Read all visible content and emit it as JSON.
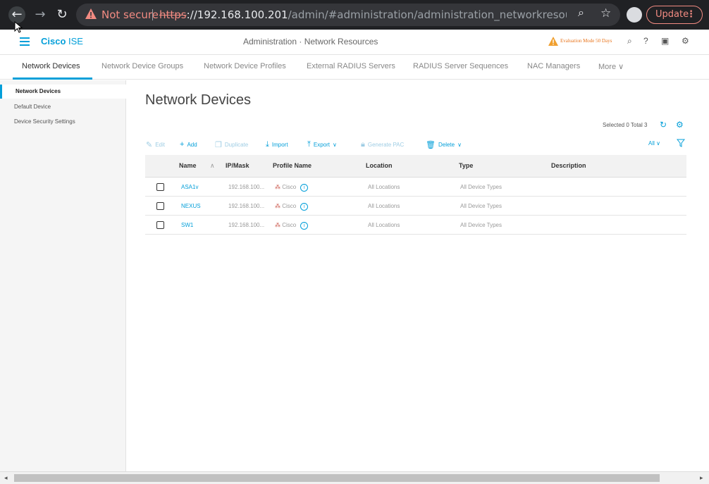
{
  "browser": {
    "not_secure": "Not secure",
    "url_scheme": "https",
    "url_rest_host": "://192.168.100.201",
    "url_path": "/admin/#administration/administration_networkresources/administrati...",
    "update_label": "Update",
    "update_dots": "⋮"
  },
  "header": {
    "brand_cisco": "Cisco",
    "brand_ise": " ISE",
    "title": "Administration · Network Resources",
    "eval_mode": "Evaluation Mode 50 Days"
  },
  "tabs": [
    "Network Devices",
    "Network Device Groups",
    "Network Device Profiles",
    "External RADIUS Servers",
    "RADIUS Server Sequences",
    "NAC Managers",
    "More"
  ],
  "sidebar": {
    "items": [
      "Network Devices",
      "Default Device",
      "Device Security Settings"
    ]
  },
  "main": {
    "title": "Network Devices",
    "summary": "Selected 0  Total 3",
    "toolbar": {
      "edit": "Edit",
      "add": "Add",
      "duplicate": "Duplicate",
      "import": "Import",
      "export": "Export",
      "generate_pac": "Generate PAC",
      "delete": "Delete",
      "filter": "All"
    },
    "columns": [
      "Name",
      "IP/Mask",
      "Profile Name",
      "Location",
      "Type",
      "Description"
    ],
    "rows": [
      {
        "name": "ASA1v",
        "ip": "192.168.100...",
        "profile": "Cisco",
        "location": "All Locations",
        "type": "All Device Types",
        "description": ""
      },
      {
        "name": "NEXUS",
        "ip": "192.168.100...",
        "profile": "Cisco",
        "location": "All Locations",
        "type": "All Device Types",
        "description": ""
      },
      {
        "name": "SW1",
        "ip": "192.168.100...",
        "profile": "Cisco",
        "location": "All Locations",
        "type": "All Device Types",
        "description": ""
      }
    ]
  },
  "colors": {
    "accent": "#049fd9",
    "browser_bg": "#202124",
    "warning": "#f28b82",
    "eval_orange": "#e8731a"
  }
}
